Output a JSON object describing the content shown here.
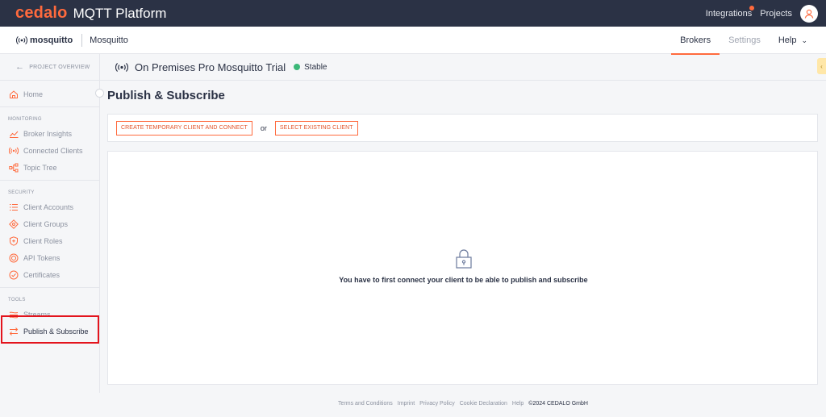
{
  "app": {
    "brand": "cedalo",
    "product": "MQTT Platform"
  },
  "topbar": {
    "integrations_label": "Integrations",
    "projects_label": "Projects",
    "has_notification": true,
    "accent_color": "#ff6a3d",
    "avatar_icon": "user-icon"
  },
  "subheader": {
    "logo_text": "mosquitto",
    "project_name": "Mosquitto",
    "nav": [
      {
        "label": "Brokers",
        "active": true
      },
      {
        "label": "Settings",
        "active": false
      },
      {
        "label": "Help",
        "active": false
      }
    ]
  },
  "sidebar": {
    "back_label": "PROJECT OVERVIEW",
    "home": {
      "label": "Home",
      "icon": "home-icon"
    },
    "sections": [
      {
        "label": "MONITORING",
        "items": [
          {
            "label": "Broker Insights",
            "icon": "chart-icon"
          },
          {
            "label": "Connected Clients",
            "icon": "broadcast-icon"
          },
          {
            "label": "Topic Tree",
            "icon": "tree-icon"
          }
        ]
      },
      {
        "label": "SECURITY",
        "items": [
          {
            "label": "Client Accounts",
            "icon": "list-icon"
          },
          {
            "label": "Client Groups",
            "icon": "groups-icon"
          },
          {
            "label": "Client Roles",
            "icon": "shield-icon"
          },
          {
            "label": "API Tokens",
            "icon": "token-icon"
          },
          {
            "label": "Certificates",
            "icon": "certificate-icon"
          }
        ]
      },
      {
        "label": "TOOLS",
        "items": [
          {
            "label": "Streams",
            "icon": "streams-icon"
          },
          {
            "label": "Publish & Subscribe",
            "icon": "swap-icon",
            "active": true
          }
        ]
      }
    ],
    "highlight_color": "#e3141d"
  },
  "broker": {
    "name": "On Premises Pro Mosquitto Trial",
    "status": "Stable",
    "status_color": "#3cb878"
  },
  "page": {
    "title": "Publish & Subscribe",
    "create_button": "CREATE TEMPORARY CLIENT AND CONNECT",
    "or_label": "or",
    "select_button": "SELECT EXISTING CLIENT",
    "empty_message": "You have to first connect your client to be able to publish and subscribe",
    "empty_icon": "lock-icon"
  },
  "footer": {
    "links": [
      "Terms and Conditions",
      "Imprint",
      "Privacy Policy",
      "Cookie Declaration",
      "Help"
    ],
    "copyright": "©2024 CEDALO GmbH"
  }
}
